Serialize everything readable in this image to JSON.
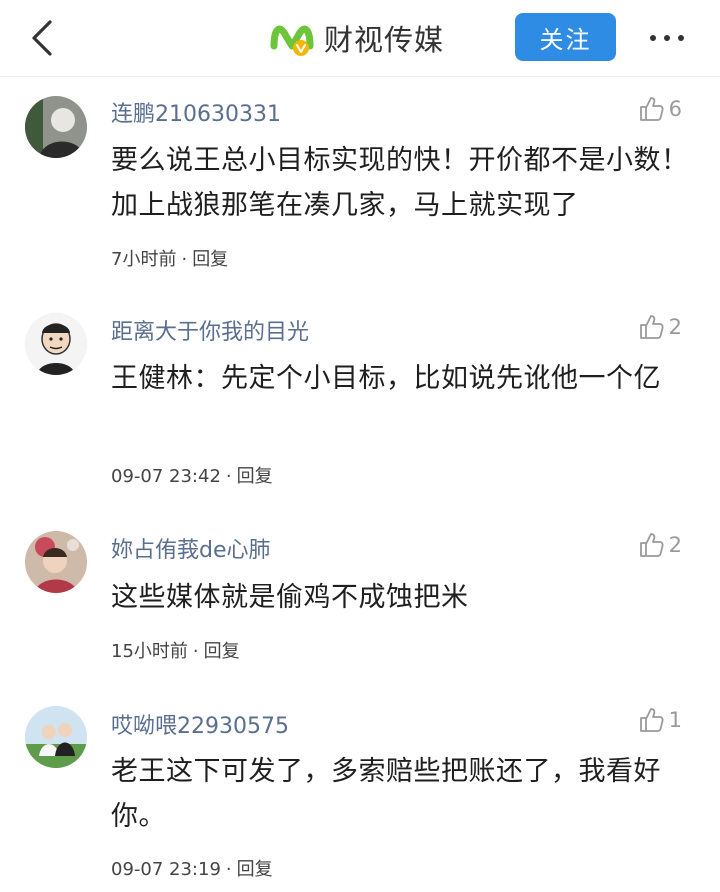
{
  "header": {
    "brand_name": "财视传媒",
    "follow_label": "关注",
    "back_icon": "chevron-left-icon",
    "more_icon": "more-dots-icon"
  },
  "comments": [
    {
      "username": "连鹏210630331",
      "likes": "6",
      "text": "要么说王总小目标实现的快！开价都不是小数！加上战狼那笔在凑几家，马上就实现了",
      "time": "7小时前",
      "reply": "回复"
    },
    {
      "username": "距离大于你我的目光",
      "likes": "2",
      "text": "王健林：先定个小目标，比如说先讹他一个亿",
      "time": "09-07 23:42",
      "reply": "回复"
    },
    {
      "username": "妳占侑莪de心肺",
      "likes": "2",
      "text": "这些媒体就是偷鸡不成蚀把米",
      "time": "15小时前",
      "reply": "回复"
    },
    {
      "username": "哎呦喂22930575",
      "likes": "1",
      "text": "老王这下可发了，多索赔些把账还了，我看好你。",
      "time": "09-07 23:19",
      "reply": "回复"
    }
  ],
  "meta_separator": "·",
  "colors": {
    "accent": "#2f8ce4",
    "username": "#5a6f8f",
    "like": "#9a9a9a",
    "logo_green": "#6cc53a",
    "logo_gold": "#f2b705"
  }
}
